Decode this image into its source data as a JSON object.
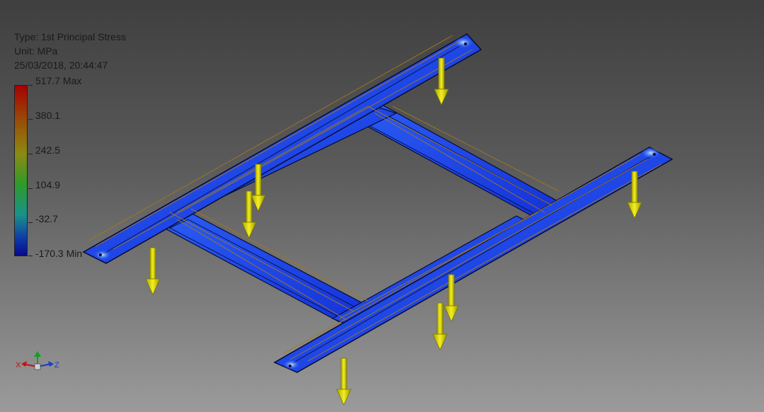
{
  "result_info": {
    "type_line": "Type: 1st Principal Stress",
    "unit_line": "Unit: MPa",
    "date_line": "25/03/2018, 20:44:47"
  },
  "legend": {
    "max_label": "517.7 Max",
    "labels": [
      "380.1",
      "242.5",
      "104.9",
      "-32.7"
    ],
    "min_label": "-170.3 Min",
    "colors": [
      "#a80000",
      "#9a4a08",
      "#8c8a12",
      "#2f9a2a",
      "#19928a",
      "#0e3aa8",
      "#060a8c"
    ]
  },
  "triad": {
    "x_label": "X",
    "y_label": "Y",
    "z_label": "Z"
  },
  "model": {
    "name": "frame-structure",
    "body_color": "#1f44ee",
    "highlight_color": "#5aa0ff",
    "wire_color": "#a07820",
    "load_arrow_color": "#d8d400"
  }
}
